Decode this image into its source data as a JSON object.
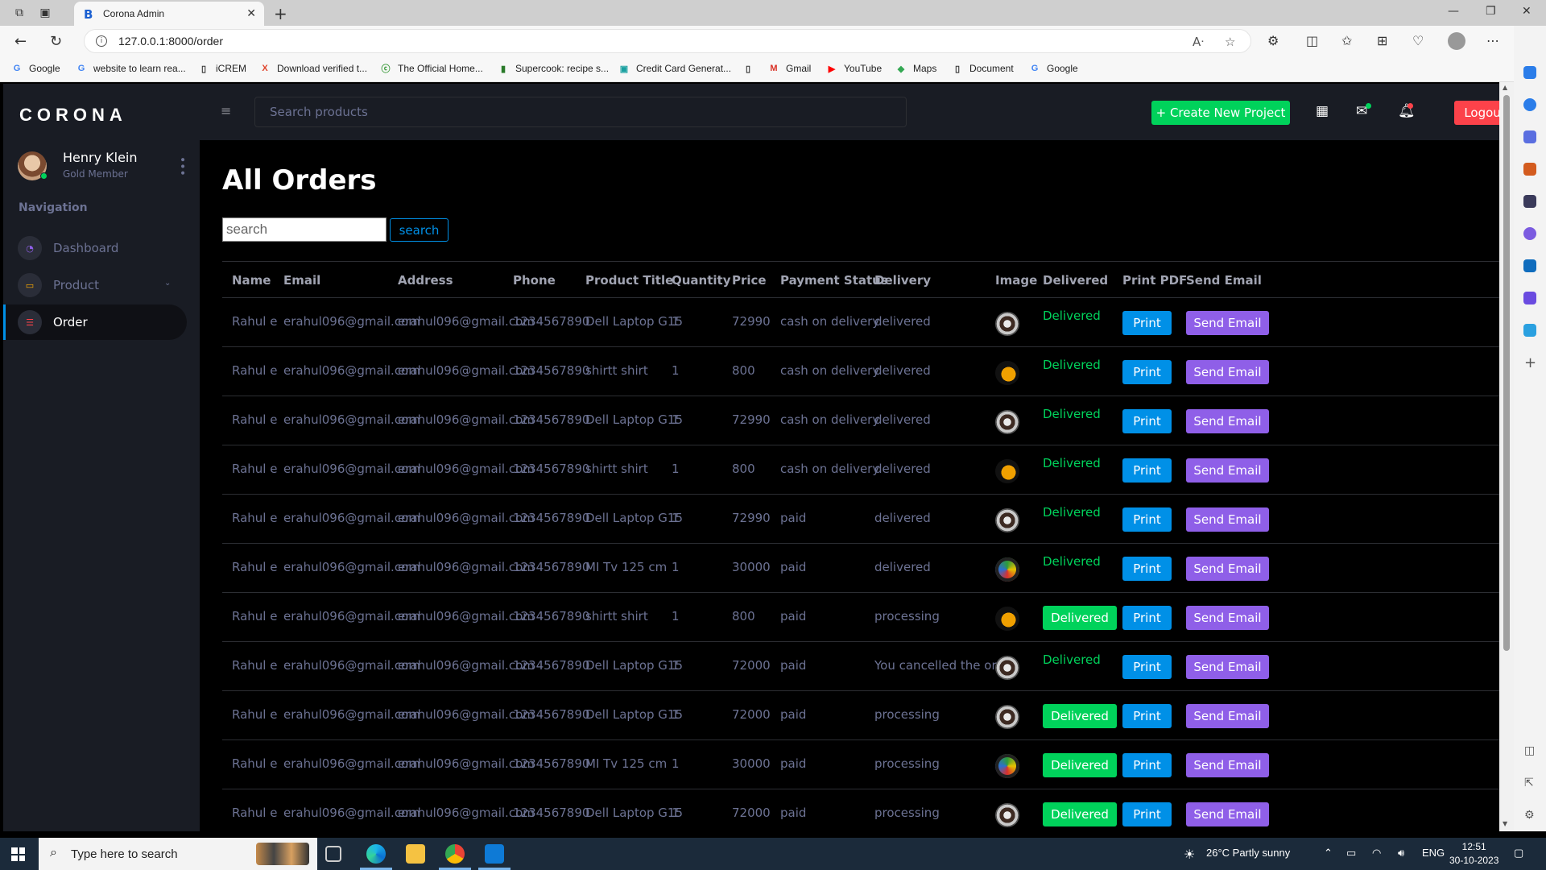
{
  "browser": {
    "tab_title": "Corona Admin",
    "tab_favicon": "B",
    "url": "127.0.0.1:8000/order",
    "bookmarks": [
      {
        "label": "Google",
        "icon": "G",
        "color": "#4285f4"
      },
      {
        "label": "website to learn rea...",
        "icon": "G",
        "color": "#4285f4"
      },
      {
        "label": "iCREM",
        "icon": "▯",
        "color": "#333333"
      },
      {
        "label": "Download verified t...",
        "icon": "X",
        "color": "#e0442c"
      },
      {
        "label": "The Official Home...",
        "icon": "ⓒ",
        "color": "#3a9a3a"
      },
      {
        "label": "Supercook: recipe s...",
        "icon": "▮",
        "color": "#2a7a2a"
      },
      {
        "label": "Credit Card Generat...",
        "icon": "▣",
        "color": "#19a0a0"
      },
      {
        "label": "",
        "icon": "▯",
        "color": "#333333"
      },
      {
        "label": "Gmail",
        "icon": "M",
        "color": "#d93025"
      },
      {
        "label": "YouTube",
        "icon": "▶",
        "color": "#ff0000"
      },
      {
        "label": "Maps",
        "icon": "◆",
        "color": "#34a853"
      },
      {
        "label": "Document",
        "icon": "▯",
        "color": "#333333"
      },
      {
        "label": "Google",
        "icon": "G",
        "color": "#4285f4"
      }
    ]
  },
  "sidebar": {
    "brand": "CORONA",
    "user_name": "Henry Klein",
    "user_role": "Gold Member",
    "nav_heading": "Navigation",
    "items": [
      {
        "label": "Dashboard",
        "icon": "speedometer-icon",
        "color": "#8f5fe8"
      },
      {
        "label": "Product",
        "icon": "laptop-icon",
        "color": "#ffab00"
      },
      {
        "label": "Order",
        "icon": "list-icon",
        "color": "#fc424a"
      }
    ]
  },
  "topnav": {
    "search_placeholder": "Search products",
    "create_label": "+ Create New Project",
    "logout_label": "Logout"
  },
  "page": {
    "title": "All Orders",
    "search_placeholder": "search",
    "search_button": "search"
  },
  "table": {
    "headers": [
      "Name",
      "Email",
      "Address",
      "Phone",
      "Product Title",
      "Quantity",
      "Price",
      "Payment Status",
      "Delivery",
      "Image",
      "Delivered",
      "Print PDF",
      "Send Email"
    ],
    "print_label": "Print",
    "email_label": "Send Email",
    "rows": [
      {
        "name": "Rahul e",
        "email": "erahul096@gmail.com",
        "address": "erahul096@gmail.com",
        "phone": "1234567890",
        "product": "Dell Laptop G15",
        "quantity": "1",
        "price": "72990",
        "payment": "cash on delivery",
        "delivery": "delivered",
        "image": "laptop",
        "delivered": "Delivered",
        "delivered_style": "text"
      },
      {
        "name": "Rahul e",
        "email": "erahul096@gmail.com",
        "address": "erahul096@gmail.com",
        "phone": "1234567890",
        "product": "shirtt shirt",
        "quantity": "1",
        "price": "800",
        "payment": "cash on delivery",
        "delivery": "delivered",
        "image": "shirt",
        "delivered": "Delivered",
        "delivered_style": "text"
      },
      {
        "name": "Rahul e",
        "email": "erahul096@gmail.com",
        "address": "erahul096@gmail.com",
        "phone": "1234567890",
        "product": "Dell Laptop G15",
        "quantity": "1",
        "price": "72990",
        "payment": "cash on delivery",
        "delivery": "delivered",
        "image": "laptop",
        "delivered": "Delivered",
        "delivered_style": "text"
      },
      {
        "name": "Rahul e",
        "email": "erahul096@gmail.com",
        "address": "erahul096@gmail.com",
        "phone": "1234567890",
        "product": "shirtt shirt",
        "quantity": "1",
        "price": "800",
        "payment": "cash on delivery",
        "delivery": "delivered",
        "image": "shirt",
        "delivered": "Delivered",
        "delivered_style": "text"
      },
      {
        "name": "Rahul e",
        "email": "erahul096@gmail.com",
        "address": "erahul096@gmail.com",
        "phone": "1234567890",
        "product": "Dell Laptop G15",
        "quantity": "1",
        "price": "72990",
        "payment": "paid",
        "delivery": "delivered",
        "image": "laptop",
        "delivered": "Delivered",
        "delivered_style": "text"
      },
      {
        "name": "Rahul e",
        "email": "erahul096@gmail.com",
        "address": "erahul096@gmail.com",
        "phone": "1234567890",
        "product": "MI Tv 125 cm",
        "quantity": "1",
        "price": "30000",
        "payment": "paid",
        "delivery": "delivered",
        "image": "tv",
        "delivered": "Delivered",
        "delivered_style": "text"
      },
      {
        "name": "Rahul e",
        "email": "erahul096@gmail.com",
        "address": "erahul096@gmail.com",
        "phone": "1234567890",
        "product": "shirtt shirt",
        "quantity": "1",
        "price": "800",
        "payment": "paid",
        "delivery": "processing",
        "image": "shirt",
        "delivered": "Delivered",
        "delivered_style": "button"
      },
      {
        "name": "Rahul e",
        "email": "erahul096@gmail.com",
        "address": "erahul096@gmail.com",
        "phone": "1234567890",
        "product": "Dell Laptop G15",
        "quantity": "1",
        "price": "72000",
        "payment": "paid",
        "delivery": "You cancelled the order",
        "image": "laptop",
        "delivered": "Delivered",
        "delivered_style": "text"
      },
      {
        "name": "Rahul e",
        "email": "erahul096@gmail.com",
        "address": "erahul096@gmail.com",
        "phone": "1234567890",
        "product": "Dell Laptop G15",
        "quantity": "1",
        "price": "72000",
        "payment": "paid",
        "delivery": "processing",
        "image": "laptop",
        "delivered": "Delivered",
        "delivered_style": "button"
      },
      {
        "name": "Rahul e",
        "email": "erahul096@gmail.com",
        "address": "erahul096@gmail.com",
        "phone": "1234567890",
        "product": "MI Tv 125 cm",
        "quantity": "1",
        "price": "30000",
        "payment": "paid",
        "delivery": "processing",
        "image": "tv",
        "delivered": "Delivered",
        "delivered_style": "button"
      },
      {
        "name": "Rahul e",
        "email": "erahul096@gmail.com",
        "address": "erahul096@gmail.com",
        "phone": "1234567890",
        "product": "Dell Laptop G15",
        "quantity": "1",
        "price": "72000",
        "payment": "paid",
        "delivery": "processing",
        "image": "laptop",
        "delivered": "Delivered",
        "delivered_style": "button"
      }
    ]
  },
  "taskbar": {
    "search_placeholder": "Type here to search",
    "weather": "26°C  Partly sunny",
    "lang": "ENG",
    "time": "12:51",
    "date": "30-10-2023"
  },
  "colors": {
    "success": "#00d25b",
    "primary": "#0090e7",
    "purple": "#8f5fe8",
    "danger": "#fc424a",
    "sidebar_bg": "#191c24"
  }
}
